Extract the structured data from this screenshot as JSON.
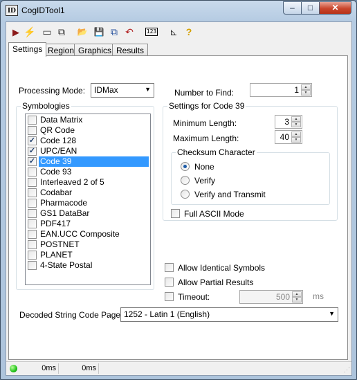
{
  "window": {
    "icon_text": "ID",
    "title": "CogIDTool1",
    "minimize_glyph": "–",
    "maximize_glyph": "□",
    "close_glyph": "✕"
  },
  "toolbar": {
    "icons": [
      {
        "name": "run-icon",
        "glyph": "▶",
        "color": "#8b1a1a"
      },
      {
        "name": "live-icon",
        "glyph": "⚡",
        "color": "#e6b800"
      },
      {
        "name": "image-source-icon",
        "glyph": "▭",
        "color": "#333333"
      },
      {
        "name": "train-icon",
        "glyph": "⧉",
        "color": "#333333"
      },
      {
        "name": "open-folder-icon",
        "glyph": "📂",
        "color": "#c9a227"
      },
      {
        "name": "save-icon",
        "glyph": "💾",
        "color": "#2b3a67"
      },
      {
        "name": "copy-icon",
        "glyph": "⧉",
        "color": "#1e4a9a"
      },
      {
        "name": "reset-icon",
        "glyph": "↶",
        "color": "#b22222"
      },
      {
        "name": "numeric-display-icon",
        "glyph": "123",
        "color": "#000000"
      },
      {
        "name": "settings-icon",
        "glyph": "⊾",
        "color": "#333333"
      },
      {
        "name": "help-icon",
        "glyph": "?",
        "color": "#d4a000"
      }
    ]
  },
  "tabs": [
    "Settings",
    "Region",
    "Graphics",
    "Results"
  ],
  "settings": {
    "processing_mode_label": "Processing Mode:",
    "processing_mode_value": "IDMax",
    "number_to_find_label": "Number to Find:",
    "number_to_find_value": "1",
    "symbologies_title": "Symbologies",
    "symbologies": [
      {
        "label": "Data Matrix",
        "checked": false,
        "selected": false
      },
      {
        "label": "QR Code",
        "checked": false,
        "selected": false
      },
      {
        "label": "Code 128",
        "checked": true,
        "selected": false
      },
      {
        "label": "UPC/EAN",
        "checked": true,
        "selected": false
      },
      {
        "label": "Code 39",
        "checked": true,
        "selected": true
      },
      {
        "label": "Code 93",
        "checked": false,
        "selected": false
      },
      {
        "label": "Interleaved 2 of 5",
        "checked": false,
        "selected": false
      },
      {
        "label": "Codabar",
        "checked": false,
        "selected": false
      },
      {
        "label": "Pharmacode",
        "checked": false,
        "selected": false
      },
      {
        "label": "GS1 DataBar",
        "checked": false,
        "selected": false
      },
      {
        "label": "PDF417",
        "checked": false,
        "selected": false
      },
      {
        "label": "EAN.UCC Composite",
        "checked": false,
        "selected": false
      },
      {
        "label": "POSTNET",
        "checked": false,
        "selected": false
      },
      {
        "label": "PLANET",
        "checked": false,
        "selected": false
      },
      {
        "label": "4-State Postal",
        "checked": false,
        "selected": false
      }
    ],
    "code_settings_title": "Settings for Code 39",
    "min_length_label": "Minimum Length:",
    "min_length_value": "3",
    "max_length_label": "Maximum Length:",
    "max_length_value": "40",
    "checksum_title": "Checksum Character",
    "checksum_options": [
      {
        "label": "None",
        "checked": true
      },
      {
        "label": "Verify",
        "checked": false
      },
      {
        "label": "Verify and Transmit",
        "checked": false
      }
    ],
    "full_ascii_label": "Full ASCII Mode",
    "allow_identical_label": "Allow Identical Symbols",
    "allow_partial_label": "Allow Partial Results",
    "timeout_label": "Timeout:",
    "timeout_value": "500",
    "timeout_unit": "ms",
    "code_page_label": "Decoded String Code Page:",
    "code_page_value": "1252 - Latin 1 (English)"
  },
  "statusbar": {
    "time1": "0ms",
    "time2": "0ms",
    "status_color": "#21c21a"
  }
}
